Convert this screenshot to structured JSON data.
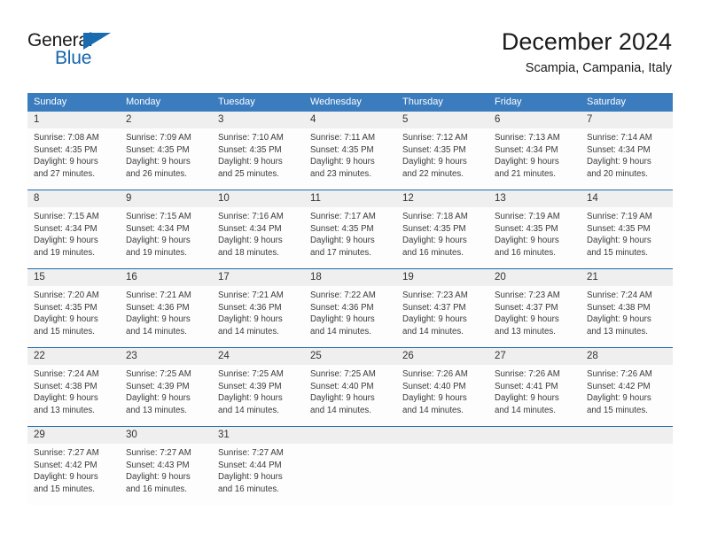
{
  "brand": {
    "name_dark": "General",
    "name_blue": "Blue",
    "accent_color": "#1a6bb0",
    "header_color": "#3a7cbe",
    "daynum_band_color": "#efefef"
  },
  "header": {
    "title": "December 2024",
    "subtitle": "Scampia, Campania, Italy"
  },
  "calendar": {
    "weekdays": [
      "Sunday",
      "Monday",
      "Tuesday",
      "Wednesday",
      "Thursday",
      "Friday",
      "Saturday"
    ],
    "weeks": [
      [
        {
          "day": "1",
          "sunrise": "Sunrise: 7:08 AM",
          "sunset": "Sunset: 4:35 PM",
          "daylight1": "Daylight: 9 hours",
          "daylight2": "and 27 minutes."
        },
        {
          "day": "2",
          "sunrise": "Sunrise: 7:09 AM",
          "sunset": "Sunset: 4:35 PM",
          "daylight1": "Daylight: 9 hours",
          "daylight2": "and 26 minutes."
        },
        {
          "day": "3",
          "sunrise": "Sunrise: 7:10 AM",
          "sunset": "Sunset: 4:35 PM",
          "daylight1": "Daylight: 9 hours",
          "daylight2": "and 25 minutes."
        },
        {
          "day": "4",
          "sunrise": "Sunrise: 7:11 AM",
          "sunset": "Sunset: 4:35 PM",
          "daylight1": "Daylight: 9 hours",
          "daylight2": "and 23 minutes."
        },
        {
          "day": "5",
          "sunrise": "Sunrise: 7:12 AM",
          "sunset": "Sunset: 4:35 PM",
          "daylight1": "Daylight: 9 hours",
          "daylight2": "and 22 minutes."
        },
        {
          "day": "6",
          "sunrise": "Sunrise: 7:13 AM",
          "sunset": "Sunset: 4:34 PM",
          "daylight1": "Daylight: 9 hours",
          "daylight2": "and 21 minutes."
        },
        {
          "day": "7",
          "sunrise": "Sunrise: 7:14 AM",
          "sunset": "Sunset: 4:34 PM",
          "daylight1": "Daylight: 9 hours",
          "daylight2": "and 20 minutes."
        }
      ],
      [
        {
          "day": "8",
          "sunrise": "Sunrise: 7:15 AM",
          "sunset": "Sunset: 4:34 PM",
          "daylight1": "Daylight: 9 hours",
          "daylight2": "and 19 minutes."
        },
        {
          "day": "9",
          "sunrise": "Sunrise: 7:15 AM",
          "sunset": "Sunset: 4:34 PM",
          "daylight1": "Daylight: 9 hours",
          "daylight2": "and 19 minutes."
        },
        {
          "day": "10",
          "sunrise": "Sunrise: 7:16 AM",
          "sunset": "Sunset: 4:34 PM",
          "daylight1": "Daylight: 9 hours",
          "daylight2": "and 18 minutes."
        },
        {
          "day": "11",
          "sunrise": "Sunrise: 7:17 AM",
          "sunset": "Sunset: 4:35 PM",
          "daylight1": "Daylight: 9 hours",
          "daylight2": "and 17 minutes."
        },
        {
          "day": "12",
          "sunrise": "Sunrise: 7:18 AM",
          "sunset": "Sunset: 4:35 PM",
          "daylight1": "Daylight: 9 hours",
          "daylight2": "and 16 minutes."
        },
        {
          "day": "13",
          "sunrise": "Sunrise: 7:19 AM",
          "sunset": "Sunset: 4:35 PM",
          "daylight1": "Daylight: 9 hours",
          "daylight2": "and 16 minutes."
        },
        {
          "day": "14",
          "sunrise": "Sunrise: 7:19 AM",
          "sunset": "Sunset: 4:35 PM",
          "daylight1": "Daylight: 9 hours",
          "daylight2": "and 15 minutes."
        }
      ],
      [
        {
          "day": "15",
          "sunrise": "Sunrise: 7:20 AM",
          "sunset": "Sunset: 4:35 PM",
          "daylight1": "Daylight: 9 hours",
          "daylight2": "and 15 minutes."
        },
        {
          "day": "16",
          "sunrise": "Sunrise: 7:21 AM",
          "sunset": "Sunset: 4:36 PM",
          "daylight1": "Daylight: 9 hours",
          "daylight2": "and 14 minutes."
        },
        {
          "day": "17",
          "sunrise": "Sunrise: 7:21 AM",
          "sunset": "Sunset: 4:36 PM",
          "daylight1": "Daylight: 9 hours",
          "daylight2": "and 14 minutes."
        },
        {
          "day": "18",
          "sunrise": "Sunrise: 7:22 AM",
          "sunset": "Sunset: 4:36 PM",
          "daylight1": "Daylight: 9 hours",
          "daylight2": "and 14 minutes."
        },
        {
          "day": "19",
          "sunrise": "Sunrise: 7:23 AM",
          "sunset": "Sunset: 4:37 PM",
          "daylight1": "Daylight: 9 hours",
          "daylight2": "and 14 minutes."
        },
        {
          "day": "20",
          "sunrise": "Sunrise: 7:23 AM",
          "sunset": "Sunset: 4:37 PM",
          "daylight1": "Daylight: 9 hours",
          "daylight2": "and 13 minutes."
        },
        {
          "day": "21",
          "sunrise": "Sunrise: 7:24 AM",
          "sunset": "Sunset: 4:38 PM",
          "daylight1": "Daylight: 9 hours",
          "daylight2": "and 13 minutes."
        }
      ],
      [
        {
          "day": "22",
          "sunrise": "Sunrise: 7:24 AM",
          "sunset": "Sunset: 4:38 PM",
          "daylight1": "Daylight: 9 hours",
          "daylight2": "and 13 minutes."
        },
        {
          "day": "23",
          "sunrise": "Sunrise: 7:25 AM",
          "sunset": "Sunset: 4:39 PM",
          "daylight1": "Daylight: 9 hours",
          "daylight2": "and 13 minutes."
        },
        {
          "day": "24",
          "sunrise": "Sunrise: 7:25 AM",
          "sunset": "Sunset: 4:39 PM",
          "daylight1": "Daylight: 9 hours",
          "daylight2": "and 14 minutes."
        },
        {
          "day": "25",
          "sunrise": "Sunrise: 7:25 AM",
          "sunset": "Sunset: 4:40 PM",
          "daylight1": "Daylight: 9 hours",
          "daylight2": "and 14 minutes."
        },
        {
          "day": "26",
          "sunrise": "Sunrise: 7:26 AM",
          "sunset": "Sunset: 4:40 PM",
          "daylight1": "Daylight: 9 hours",
          "daylight2": "and 14 minutes."
        },
        {
          "day": "27",
          "sunrise": "Sunrise: 7:26 AM",
          "sunset": "Sunset: 4:41 PM",
          "daylight1": "Daylight: 9 hours",
          "daylight2": "and 14 minutes."
        },
        {
          "day": "28",
          "sunrise": "Sunrise: 7:26 AM",
          "sunset": "Sunset: 4:42 PM",
          "daylight1": "Daylight: 9 hours",
          "daylight2": "and 15 minutes."
        }
      ],
      [
        {
          "day": "29",
          "sunrise": "Sunrise: 7:27 AM",
          "sunset": "Sunset: 4:42 PM",
          "daylight1": "Daylight: 9 hours",
          "daylight2": "and 15 minutes."
        },
        {
          "day": "30",
          "sunrise": "Sunrise: 7:27 AM",
          "sunset": "Sunset: 4:43 PM",
          "daylight1": "Daylight: 9 hours",
          "daylight2": "and 16 minutes."
        },
        {
          "day": "31",
          "sunrise": "Sunrise: 7:27 AM",
          "sunset": "Sunset: 4:44 PM",
          "daylight1": "Daylight: 9 hours",
          "daylight2": "and 16 minutes."
        },
        {
          "day": "",
          "sunrise": "",
          "sunset": "",
          "daylight1": "",
          "daylight2": ""
        },
        {
          "day": "",
          "sunrise": "",
          "sunset": "",
          "daylight1": "",
          "daylight2": ""
        },
        {
          "day": "",
          "sunrise": "",
          "sunset": "",
          "daylight1": "",
          "daylight2": ""
        },
        {
          "day": "",
          "sunrise": "",
          "sunset": "",
          "daylight1": "",
          "daylight2": ""
        }
      ]
    ]
  }
}
